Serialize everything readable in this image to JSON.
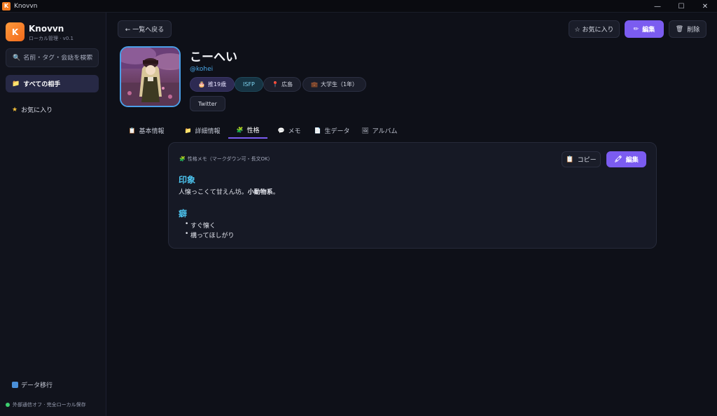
{
  "window": {
    "title": "Knovvn",
    "icon_letter": "K"
  },
  "sidebar": {
    "brand_name": "Knovvn",
    "brand_sub": "ローカル管理 · v0.1",
    "search_placeholder": "名前・タグ・会話を検索",
    "items": [
      {
        "label": "すべての相手",
        "icon": "folder-icon"
      },
      {
        "label": "お気に入り",
        "icon": "star-icon"
      }
    ],
    "migrate_label": "データ移行",
    "status_text": "外部通信オフ · 完全ローカル保存"
  },
  "header": {
    "back_label": "← 一覧へ戻る",
    "favorite_label": "☆ お気に入り",
    "edit_label": "編集",
    "delete_label": "削除"
  },
  "profile": {
    "name": "こーへい",
    "handle": "@kohei",
    "chips": {
      "age": "推19歳",
      "mbti": "ISFP",
      "location": "広島",
      "job": "大学生（1年）",
      "link": "Twitter"
    }
  },
  "tabs": [
    {
      "label": "基本情報",
      "icon": "clipboard-icon"
    },
    {
      "label": "詳細情報",
      "icon": "folder-icon"
    },
    {
      "label": "性格",
      "icon": "puzzle-icon",
      "active": true
    },
    {
      "label": "メモ",
      "icon": "speech-bubble-icon"
    },
    {
      "label": "生データ",
      "icon": "document-icon"
    },
    {
      "label": "アルバム",
      "icon": "picture-icon"
    }
  ],
  "personality_card": {
    "label": "性格メモ（マークダウン可・長文OK）",
    "copy_label": "コピー",
    "edit_label": "編集",
    "section1_heading": "印象",
    "section1_text_plain": "人懐っこくて甘えん坊。",
    "section1_text_bold": "小動物系",
    "section1_text_end": "。",
    "section2_heading": "癖",
    "section2_items": [
      "すぐ懐く",
      "構ってほしがり"
    ]
  },
  "colors": {
    "accent": "#7b5cf0",
    "heading": "#4cc3ee",
    "handle": "#4aa8e8",
    "background": "#0e1018"
  }
}
